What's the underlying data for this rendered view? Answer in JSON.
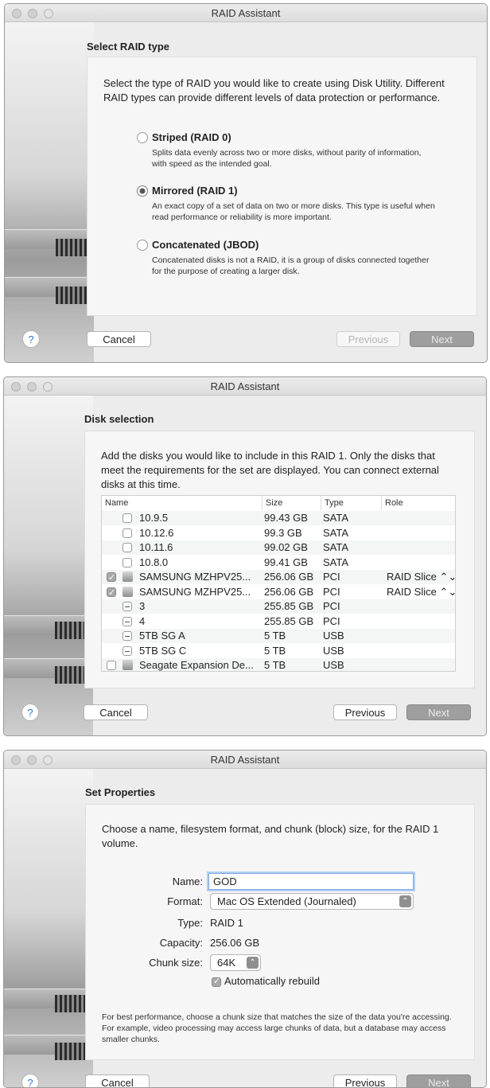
{
  "win1": {
    "title": "RAID Assistant",
    "heading": "Select RAID type",
    "intro": "Select the type of RAID you would like to create using Disk Utility. Different RAID types can provide different levels of data protection or performance.",
    "options": [
      {
        "label": "Striped (RAID 0)",
        "desc": "Splits data evenly across two or more disks, without parity of information, with speed as the intended goal.",
        "selected": false
      },
      {
        "label": "Mirrored (RAID 1)",
        "desc": "An exact copy of a set of data on two or more disks. This type is useful when read performance or reliability is more important.",
        "selected": true
      },
      {
        "label": "Concatenated (JBOD)",
        "desc": "Concatenated disks is not a RAID, it is a group of disks connected together for the purpose of creating a larger disk.",
        "selected": false
      }
    ],
    "help": "?",
    "cancel": "Cancel",
    "previous": "Previous",
    "next": "Next"
  },
  "win2": {
    "title": "RAID Assistant",
    "heading": "Disk selection",
    "intro": "Add the disks you would like to include in this RAID 1. Only the disks that meet the requirements for the set are displayed. You can connect external disks at this time.",
    "columns": [
      "Name",
      "Size",
      "Type",
      "Role"
    ],
    "rows": [
      {
        "check": "none",
        "icon": false,
        "indent": true,
        "name": "10.9.5",
        "size": "99.43 GB",
        "type": "SATA",
        "role": ""
      },
      {
        "check": "none",
        "icon": false,
        "indent": true,
        "name": "10.12.6",
        "size": "99.3 GB",
        "type": "SATA",
        "role": ""
      },
      {
        "check": "none",
        "icon": false,
        "indent": true,
        "name": "10.11.6",
        "size": "99.02 GB",
        "type": "SATA",
        "role": ""
      },
      {
        "check": "none",
        "icon": false,
        "indent": true,
        "name": "10.8.0",
        "size": "99.41 GB",
        "type": "SATA",
        "role": ""
      },
      {
        "check": "checked",
        "icon": true,
        "indent": false,
        "name": "SAMSUNG MZHPV25...",
        "size": "256.06 GB",
        "type": "PCI",
        "role": "RAID Slice ⌃⌄"
      },
      {
        "check": "checked",
        "icon": true,
        "indent": false,
        "name": "SAMSUNG MZHPV25...",
        "size": "256.06 GB",
        "type": "PCI",
        "role": "RAID Slice ⌃⌄"
      },
      {
        "check": "mixed",
        "icon": false,
        "indent": true,
        "name": "3",
        "size": "255.85 GB",
        "type": "PCI",
        "role": ""
      },
      {
        "check": "mixed",
        "icon": false,
        "indent": true,
        "name": "4",
        "size": "255.85 GB",
        "type": "PCI",
        "role": ""
      },
      {
        "check": "mixed",
        "icon": false,
        "indent": true,
        "name": "5TB SG A",
        "size": "5 TB",
        "type": "USB",
        "role": ""
      },
      {
        "check": "mixed",
        "icon": false,
        "indent": true,
        "name": "5TB SG C",
        "size": "5 TB",
        "type": "USB",
        "role": ""
      },
      {
        "check": "none",
        "icon": true,
        "indent": false,
        "name": "Seagate Expansion De...",
        "size": "5 TB",
        "type": "USB",
        "role": ""
      }
    ],
    "help": "?",
    "cancel": "Cancel",
    "previous": "Previous",
    "next": "Next"
  },
  "win3": {
    "title": "RAID Assistant",
    "heading": "Set Properties",
    "intro": "Choose a name, filesystem format, and chunk (block) size, for the RAID 1 volume.",
    "name_label": "Name:",
    "name_value": "GOD",
    "format_label": "Format:",
    "format_value": "Mac OS Extended (Journaled)",
    "type_label": "Type:",
    "type_value": "RAID 1",
    "capacity_label": "Capacity:",
    "capacity_value": "256.06 GB",
    "chunk_label": "Chunk size:",
    "chunk_value": "64K",
    "rebuild_label": "Automatically rebuild",
    "rebuild_checked": true,
    "footnote": "For best performance, choose a chunk size that matches the size of the data you're accessing. For example, video processing may access large chunks of data, but a database may access smaller chunks.",
    "help": "?",
    "cancel": "Cancel",
    "previous": "Previous",
    "next": "Next"
  }
}
